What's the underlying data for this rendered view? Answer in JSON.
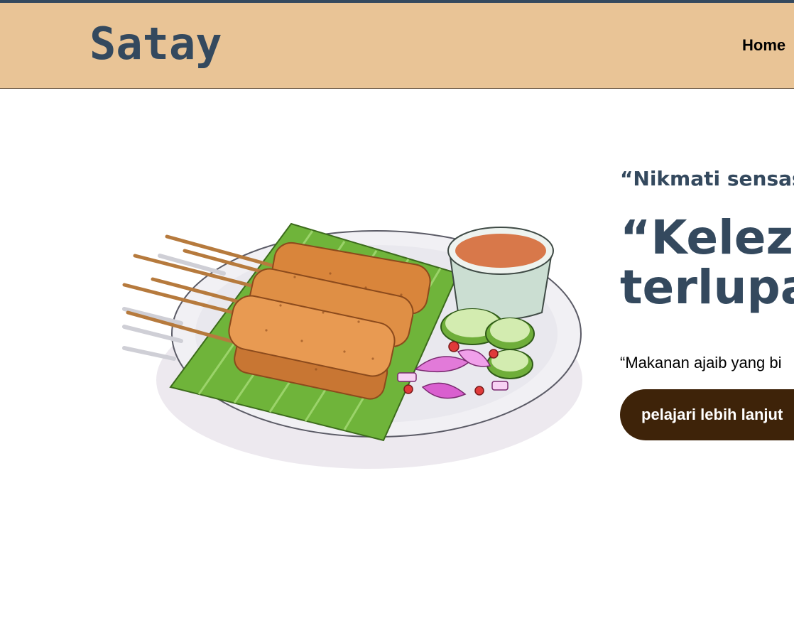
{
  "header": {
    "logo": "Satay",
    "nav": {
      "home": "Home"
    }
  },
  "hero": {
    "tagline": "“Nikmati sensasi",
    "headline_line1": "“Kelezat",
    "headline_line2": "terlupak",
    "description": "“Makanan ajaib yang bi",
    "cta_label": "pelajari lebih lanjut",
    "illustration_icon": "satay-plate-illustration"
  },
  "colors": {
    "header_bg": "#e9c496",
    "accent": "#34495e",
    "button_bg": "#3e2309"
  }
}
